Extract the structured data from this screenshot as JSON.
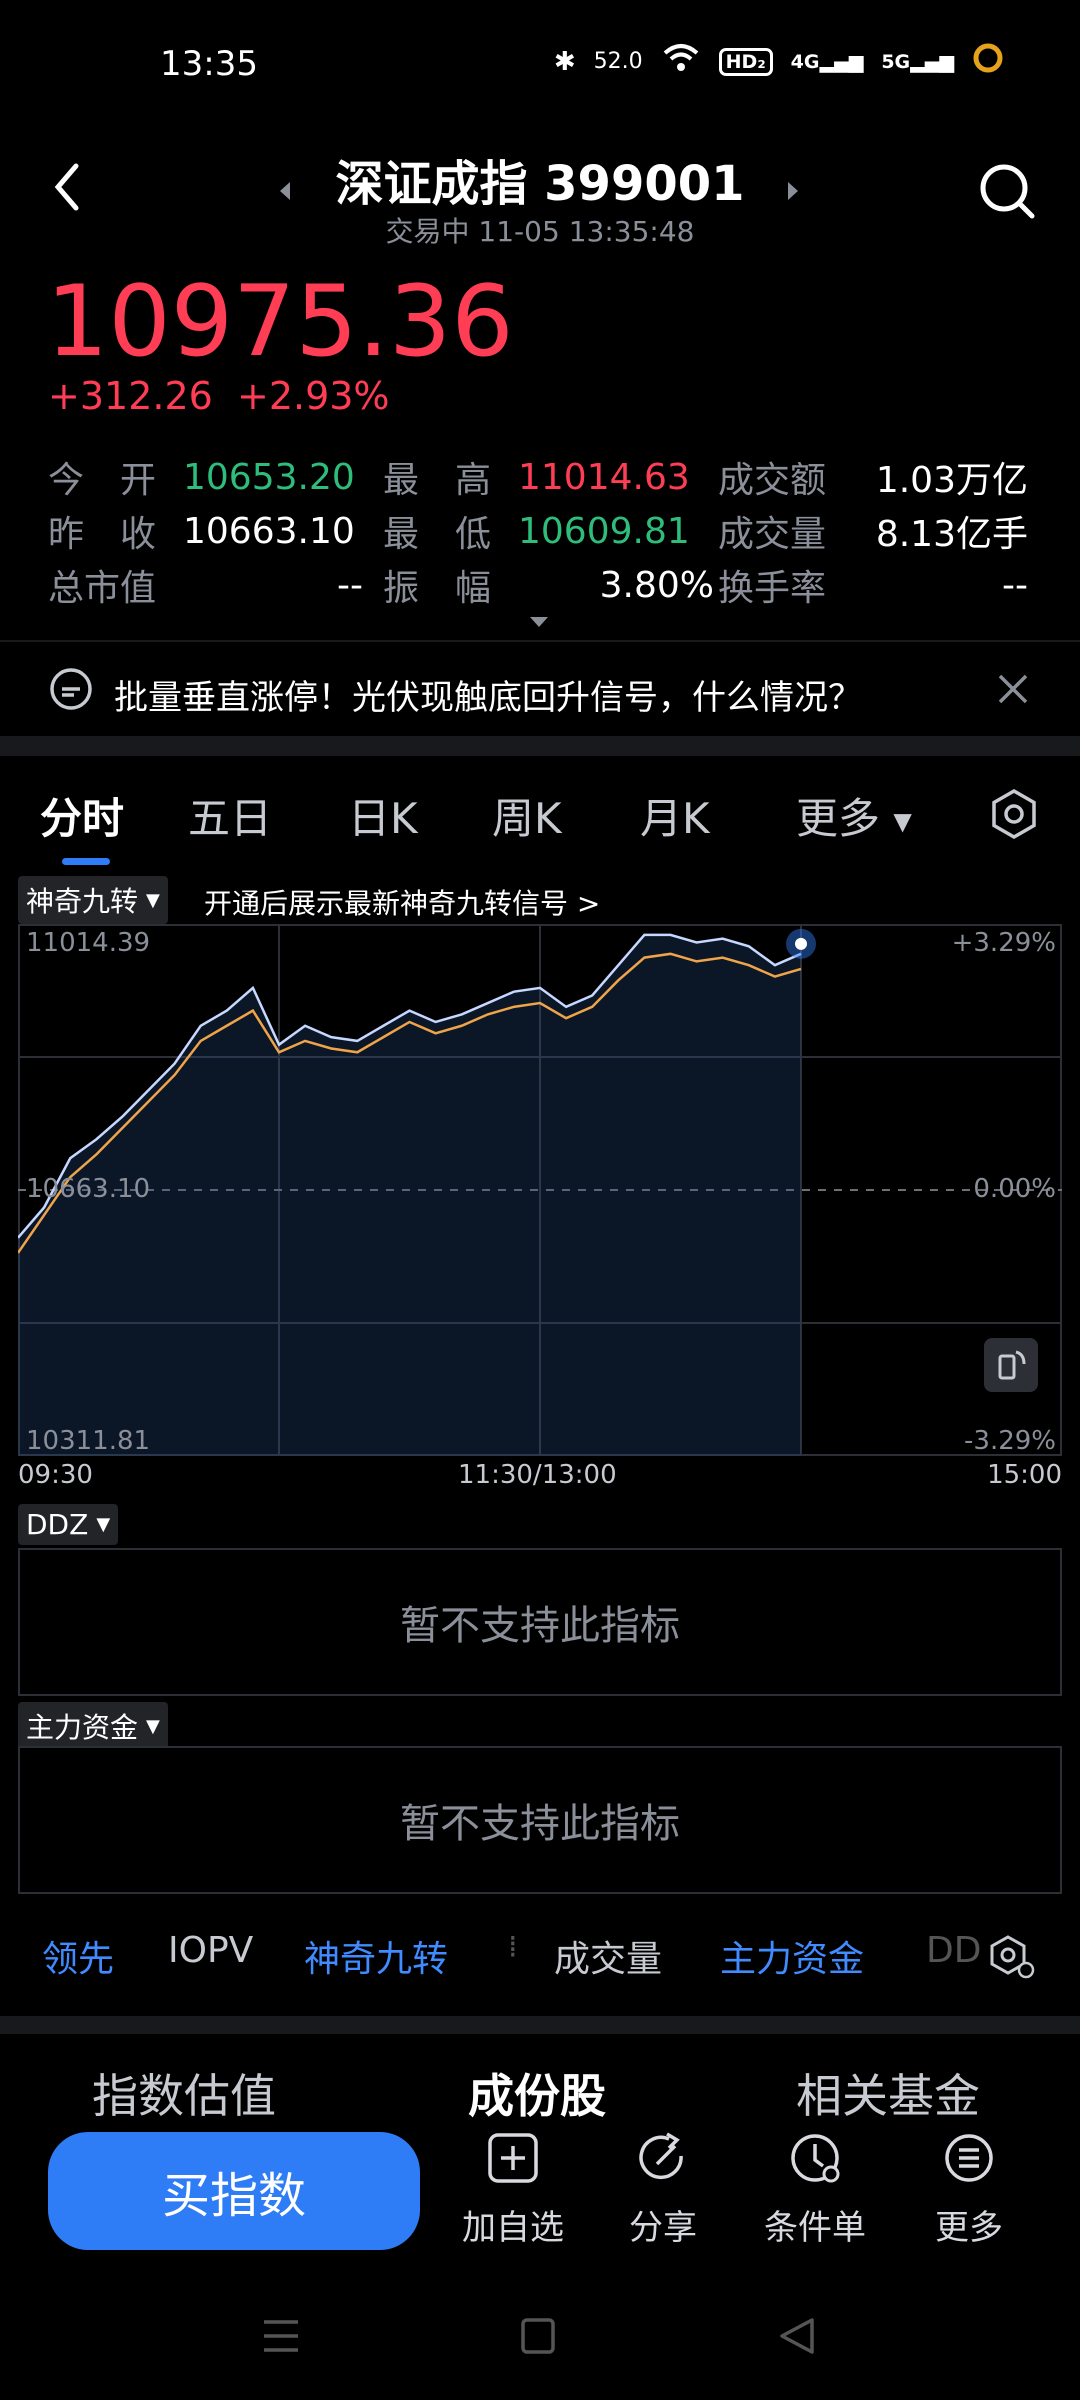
{
  "status_bar": {
    "time": "13:35",
    "speed": "52.0",
    "hd": "HD₂",
    "net1": "4G",
    "net2": "5G"
  },
  "header": {
    "title": "深证成指 399001",
    "subtitle": "交易中 11-05 13:35:48"
  },
  "quote": {
    "price": "10975.36",
    "change": "+312.26",
    "change_pct": "+2.93%"
  },
  "stats": {
    "open_label": "今　开",
    "open": "10653.20",
    "high_label": "最　高",
    "high": "11014.63",
    "amount_label": "成交额",
    "amount": "1.03万亿",
    "prev_label": "昨　收",
    "prev": "10663.10",
    "low_label": "最　低",
    "low": "10609.81",
    "volume_label": "成交量",
    "volume": "8.13亿手",
    "mcap_label": "总市值",
    "mcap": "--",
    "amp_label": "振　幅",
    "amp": "3.80%",
    "turnover_label": "换手率",
    "turnover": "--"
  },
  "news": {
    "text": "批量垂直涨停！光伏现触底回升信号，什么情况？"
  },
  "tabs": [
    "分时",
    "五日",
    "日K",
    "周K",
    "月K",
    "更多"
  ],
  "chart": {
    "indicator_name": "神奇九转",
    "indicator_hint": "开通后展示最新神奇九转信号 >",
    "y_top": "11014.39",
    "y_mid": "10663.10",
    "y_bottom": "10311.81",
    "pct_top": "+3.29%",
    "pct_mid": "0.00%",
    "pct_bottom": "-3.29%",
    "x_start": "09:30",
    "x_mid": "11:30/13:00",
    "x_end": "15:00"
  },
  "chart_data": {
    "type": "line",
    "title": "",
    "xlabel": "",
    "ylabel": "",
    "x_ticks": [
      "09:30",
      "11:30/13:00",
      "15:00"
    ],
    "ylim": [
      10311.81,
      11014.39
    ],
    "series": [
      {
        "values": [
          10600,
          10640,
          10705,
          10730,
          10760,
          10795,
          10830,
          10880,
          10900,
          10930,
          10855,
          10880,
          10865,
          10860,
          10880,
          10900,
          10885,
          10895,
          10910,
          10925,
          10930,
          10905,
          10920,
          10960,
          11000,
          11000,
          10990,
          10995,
          10985,
          10960,
          10975
        ]
      },
      {
        "values": [
          10580,
          10630,
          10680,
          10710,
          10745,
          10780,
          10815,
          10860,
          10880,
          10900,
          10845,
          10860,
          10850,
          10845,
          10865,
          10885,
          10870,
          10880,
          10895,
          10905,
          10910,
          10890,
          10905,
          10940,
          10970,
          10975,
          10965,
          10970,
          10960,
          10945,
          10955
        ]
      }
    ]
  },
  "ddz": {
    "label": "DDZ",
    "empty_text": "暂不支持此指标"
  },
  "main_funds": {
    "label": "主力资金",
    "empty_text": "暂不支持此指标"
  },
  "indicator_tabs": [
    "领先",
    "IOPV",
    "神奇九转",
    "成交量",
    "主力资金",
    "DD"
  ],
  "bottom_tabs": [
    "指数估值",
    "成份股",
    "相关基金"
  ],
  "actions": {
    "buy": "买指数",
    "watch": "加自选",
    "share": "分享",
    "condition": "条件单",
    "more": "更多"
  },
  "colors": {
    "up": "#ff3d55",
    "down": "#2ebd7b",
    "accent": "#2f7df6",
    "line_price": "#c6d8ff",
    "line_avg": "#f0a44a"
  }
}
